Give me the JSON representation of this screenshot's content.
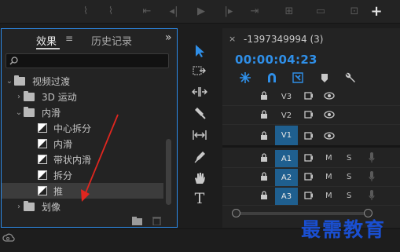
{
  "transport": {
    "step_back_symbol": "⇤",
    "step_fwd_symbol": "⇥",
    "add_symbol": "+"
  },
  "effects_panel": {
    "tab_effects": "效果",
    "tab_menu_symbol": "≡",
    "tab_history": "历史记录",
    "overflow_symbol": "»",
    "search_placeholder": "",
    "tree": [
      {
        "caret": "⌄",
        "label": "视频过渡"
      },
      {
        "caret": "›",
        "label": "3D 运动"
      },
      {
        "caret": "⌄",
        "label": "内滑"
      },
      {
        "label": "中心拆分"
      },
      {
        "label": "内滑"
      },
      {
        "label": "带状内滑"
      },
      {
        "label": "拆分"
      },
      {
        "label": "推",
        "selected": true
      },
      {
        "caret": "›",
        "label": "划像"
      }
    ]
  },
  "timeline": {
    "close_symbol": "×",
    "title": "-1397349994 (3)",
    "timecode": "00:00:04:23",
    "tracks": [
      {
        "name": "V3",
        "active": false,
        "kind": "video"
      },
      {
        "name": "V2",
        "active": false,
        "kind": "video"
      },
      {
        "name": "V1",
        "active": true,
        "kind": "video"
      },
      {
        "name": "A1",
        "active": true,
        "kind": "audio",
        "m": "M",
        "s": "S"
      },
      {
        "name": "A2",
        "active": true,
        "kind": "audio",
        "m": "M",
        "s": "S"
      },
      {
        "name": "A3",
        "active": true,
        "kind": "audio",
        "m": "M",
        "s": "S"
      }
    ]
  },
  "tools": {
    "type_tool_symbol": "T"
  },
  "watermark": "最需教育",
  "colors": {
    "accent_blue": "#2f8fe8",
    "track_blue": "#1f5f8f",
    "panel_border": "#2d8ceb",
    "annotation_red": "#e0261f",
    "watermark": "#1a4fd1"
  }
}
